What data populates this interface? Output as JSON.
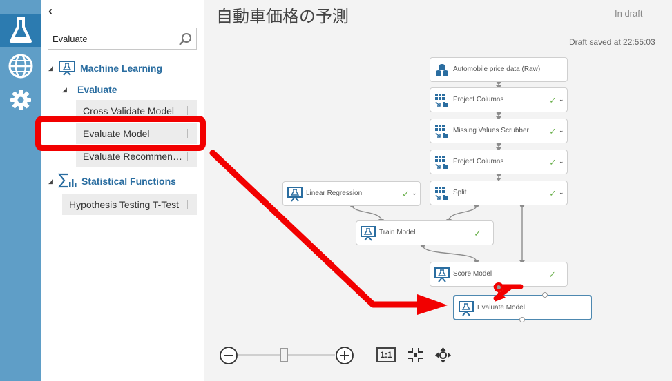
{
  "rail": {
    "items": [
      {
        "name": "experiments",
        "icon": "flask-icon"
      },
      {
        "name": "web-services",
        "icon": "globe-icon"
      },
      {
        "name": "settings",
        "icon": "gear-icon"
      }
    ]
  },
  "palette": {
    "collapse_glyph": "‹",
    "search_value": "Evaluate",
    "categories": [
      {
        "label": "Machine Learning",
        "subcategory": "Evaluate",
        "modules": [
          "Cross Validate Model",
          "Evaluate Model",
          "Evaluate Recommen…"
        ]
      },
      {
        "label": "Statistical Functions",
        "modules": [
          "Hypothesis Testing T-Test"
        ]
      }
    ]
  },
  "canvas": {
    "title": "自動車価格の予測",
    "status": "In draft",
    "saved": "Draft saved at 22:55:03",
    "nodes": [
      {
        "label": "Automobile price data (Raw)",
        "icon": "dataset-icon",
        "checked": false
      },
      {
        "label": "Project Columns",
        "icon": "grid-icon",
        "checked": true
      },
      {
        "label": "Missing Values Scrubber",
        "icon": "grid-icon",
        "checked": true
      },
      {
        "label": "Project Columns",
        "icon": "grid-icon",
        "checked": true
      },
      {
        "label": "Split",
        "icon": "grid-icon",
        "checked": true
      },
      {
        "label": "Linear Regression",
        "icon": "model-icon",
        "checked": true
      },
      {
        "label": "Train Model",
        "icon": "model-icon",
        "checked": true
      },
      {
        "label": "Score Model",
        "icon": "model-icon",
        "checked": true
      },
      {
        "label": "Evaluate Model",
        "icon": "model-icon",
        "checked": false
      }
    ],
    "check_glyph": "✓",
    "caret_glyph": "⌄"
  },
  "zoom": {
    "minus_glyph": "−",
    "plus_glyph": "+",
    "actual_size_label": "1:1",
    "slider_level": 0.48
  },
  "colors": {
    "rail_bg": "#5f9ec7",
    "rail_active": "#2c7bb0",
    "accent_text": "#2a6da0",
    "check": "#6ab04c",
    "highlight_red": "#f20000"
  }
}
